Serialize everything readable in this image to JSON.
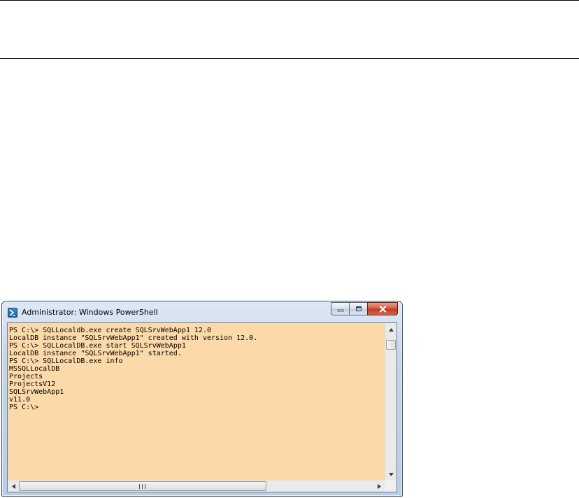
{
  "window": {
    "title": "Administrator: Windows PowerShell",
    "icon": "powershell-icon"
  },
  "caption_buttons": {
    "minimize_icon": "minimize-icon",
    "maximize_icon": "maximize-icon",
    "close_icon": "close-icon"
  },
  "console": {
    "background": "#fcd9a8",
    "foreground": "#000000",
    "lines": [
      "PS C:\\> SQLLocaldb.exe create SQLSrvWebApp1 12.0",
      "LocalDB instance \"SQLSrvWebApp1\" created with version 12.0.",
      "PS C:\\> SQLLocalDB.exe start SQLSrvWebApp1",
      "LocalDB instance \"SQLSrvWebApp1\" started.",
      "PS C:\\> SQLLocalDB.exe info",
      "MSSQLLocalDB",
      "Projects",
      "ProjectsV12",
      "SQLSrvWebApp1",
      "v11.0",
      "PS C:\\>"
    ]
  },
  "scrollbars": {
    "vertical_up_icon": "arrow-up-icon",
    "vertical_down_icon": "arrow-down-icon",
    "horizontal_left_icon": "arrow-left-icon",
    "horizontal_right_icon": "arrow-right-icon"
  }
}
